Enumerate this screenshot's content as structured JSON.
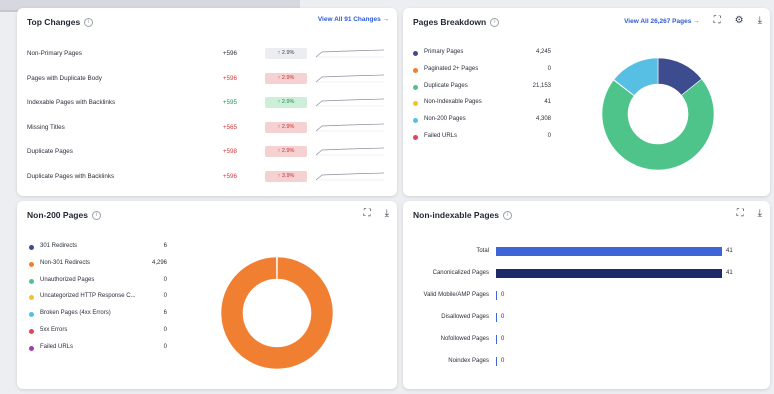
{
  "top_changes": {
    "title": "Top Changes",
    "link": "View All 91 Changes →",
    "rows": [
      {
        "label": "Non-Primary Pages",
        "value": "+596",
        "value_color": "#2b2f3b",
        "pill": "↑ 2.9%",
        "pill_bg": "#ebedf0",
        "pill_color": "#3a3f4b"
      },
      {
        "label": "Pages with Duplicate Body",
        "value": "+596",
        "value_color": "#d23a3a",
        "pill": "↑ 2.9%",
        "pill_bg": "#f6d1d1",
        "pill_color": "#c22f2f"
      },
      {
        "label": "Indexable Pages with Backlinks",
        "value": "+595",
        "value_color": "#1f9a4e",
        "pill": "↑ 2.9%",
        "pill_bg": "#cdeed8",
        "pill_color": "#1f8a45"
      },
      {
        "label": "Missing Titles",
        "value": "+565",
        "value_color": "#d23a3a",
        "pill": "↑ 2.9%",
        "pill_bg": "#f6d1d1",
        "pill_color": "#c22f2f"
      },
      {
        "label": "Duplicate Pages",
        "value": "+598",
        "value_color": "#d23a3a",
        "pill": "↑ 2.9%",
        "pill_bg": "#f6d1d1",
        "pill_color": "#c22f2f"
      },
      {
        "label": "Duplicate Pages with Backlinks",
        "value": "+596",
        "value_color": "#d23a3a",
        "pill": "↑ 3.9%",
        "pill_bg": "#f6d1d1",
        "pill_color": "#c22f2f"
      }
    ]
  },
  "pages_breakdown": {
    "title": "Pages Breakdown",
    "link": "View All 26,267 Pages →",
    "items": [
      {
        "label": "Primary Pages",
        "value": "4,245",
        "color": "#3d4c8f"
      },
      {
        "label": "Paginated 2+ Pages",
        "value": "0",
        "color": "#f07f32"
      },
      {
        "label": "Duplicate Pages",
        "value": "21,153",
        "color": "#4fc48a"
      },
      {
        "label": "Non-Indexable Pages",
        "value": "41",
        "color": "#f2c230"
      },
      {
        "label": "Non-200 Pages",
        "value": "4,308",
        "color": "#57bfe3"
      },
      {
        "label": "Failed URLs",
        "value": "0",
        "color": "#e0455a"
      }
    ]
  },
  "non200": {
    "title": "Non-200 Pages",
    "items": [
      {
        "label": "301 Redirects",
        "value": "6",
        "color": "#3d4c8f"
      },
      {
        "label": "Non-301 Redirects",
        "value": "4,296",
        "color": "#f07f32"
      },
      {
        "label": "Unauthorized Pages",
        "value": "0",
        "color": "#4fc48a"
      },
      {
        "label": "Uncategorized HTTP Response C...",
        "value": "0",
        "color": "#f2c230"
      },
      {
        "label": "Broken Pages (4xx Errors)",
        "value": "6",
        "color": "#57bfe3"
      },
      {
        "label": "5xx Errors",
        "value": "0",
        "color": "#e0455a"
      },
      {
        "label": "Failed URLs",
        "value": "0",
        "color": "#9b3fb0"
      }
    ]
  },
  "non_indexable": {
    "title": "Non-indexable Pages",
    "chart_data": {
      "type": "bar",
      "orientation": "horizontal",
      "categories": [
        "Total",
        "Canonicalized Pages",
        "Valid Mobile/AMP Pages",
        "Disallowed Pages",
        "Nofollowed Pages",
        "Noindex Pages"
      ],
      "values": [
        41,
        41,
        0,
        0,
        0,
        0
      ],
      "labels": [
        "41",
        "41",
        "0",
        "0",
        "0",
        "0"
      ],
      "colors": [
        "#3e64d8",
        "#1f2a6b",
        "#3e64d8",
        "#3e64d8",
        "#3e64d8",
        "#3e64d8"
      ],
      "xlim": [
        0,
        41
      ]
    }
  },
  "colors": {
    "accent": "#2f5bd6",
    "donut_ring_empty": "#e9ebef"
  }
}
